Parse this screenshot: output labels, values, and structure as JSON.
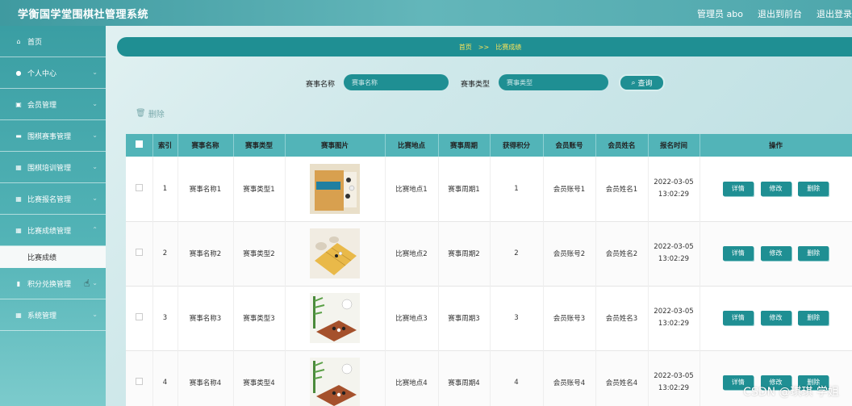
{
  "app": {
    "title": "学衡国学堂围棋社管理系统"
  },
  "header": {
    "user": "管理员 abo",
    "to_front": "退出到前台",
    "logout": "退出登录"
  },
  "sidebar": {
    "items": [
      {
        "label": "首页",
        "icon": "home-icon",
        "glyph": "⌂"
      },
      {
        "label": "个人中心",
        "icon": "user-icon",
        "glyph": "●"
      },
      {
        "label": "会员管理",
        "icon": "doc-icon",
        "glyph": "▣"
      },
      {
        "label": "围棋赛事管理",
        "icon": "monitor-icon",
        "glyph": "▬"
      },
      {
        "label": "围棋培训管理",
        "icon": "grid-icon",
        "glyph": "▦"
      },
      {
        "label": "比赛报名管理",
        "icon": "grid-icon",
        "glyph": "▦"
      },
      {
        "label": "比赛成绩管理",
        "icon": "grid-icon",
        "glyph": "▦"
      },
      {
        "label": "积分兑换管理",
        "icon": "chart-icon",
        "glyph": "▮"
      },
      {
        "label": "系统管理",
        "icon": "grid-icon",
        "glyph": "▦"
      }
    ],
    "active_sub": "比赛成绩"
  },
  "breadcrumb": {
    "home": "首页",
    "sep": ">>",
    "current": "比赛成绩"
  },
  "search": {
    "name_label": "赛事名称",
    "name_placeholder": "赛事名称",
    "type_label": "赛事类型",
    "type_placeholder": "赛事类型",
    "button": "查询"
  },
  "toolbar": {
    "delete": "删除"
  },
  "table": {
    "headers": [
      "索引",
      "赛事名称",
      "赛事类型",
      "赛事图片",
      "比赛地点",
      "赛事周期",
      "获得积分",
      "会员账号",
      "会员姓名",
      "报名时间",
      "操作"
    ],
    "rows": [
      {
        "index": "1",
        "name": "赛事名称1",
        "type": "赛事类型1",
        "place": "比赛地点1",
        "period": "赛事周期1",
        "points": "1",
        "account": "会员账号1",
        "member": "会员姓名1",
        "date": "2022-03-05",
        "time": "13:02:29"
      },
      {
        "index": "2",
        "name": "赛事名称2",
        "type": "赛事类型2",
        "place": "比赛地点2",
        "period": "赛事周期2",
        "points": "2",
        "account": "会员账号2",
        "member": "会员姓名2",
        "date": "2022-03-05",
        "time": "13:02:29"
      },
      {
        "index": "3",
        "name": "赛事名称3",
        "type": "赛事类型3",
        "place": "比赛地点3",
        "period": "赛事周期3",
        "points": "3",
        "account": "会员账号3",
        "member": "会员姓名3",
        "date": "2022-03-05",
        "time": "13:02:29"
      },
      {
        "index": "4",
        "name": "赛事名称4",
        "type": "赛事类型4",
        "place": "比赛地点4",
        "period": "赛事周期4",
        "points": "4",
        "account": "会员账号4",
        "member": "会员姓名4",
        "date": "2022-03-05",
        "time": "13:02:29"
      }
    ],
    "actions": {
      "detail": "详情",
      "edit": "修改",
      "delete": "删除"
    }
  },
  "watermark": "CSDN @琪琪 学姐"
}
